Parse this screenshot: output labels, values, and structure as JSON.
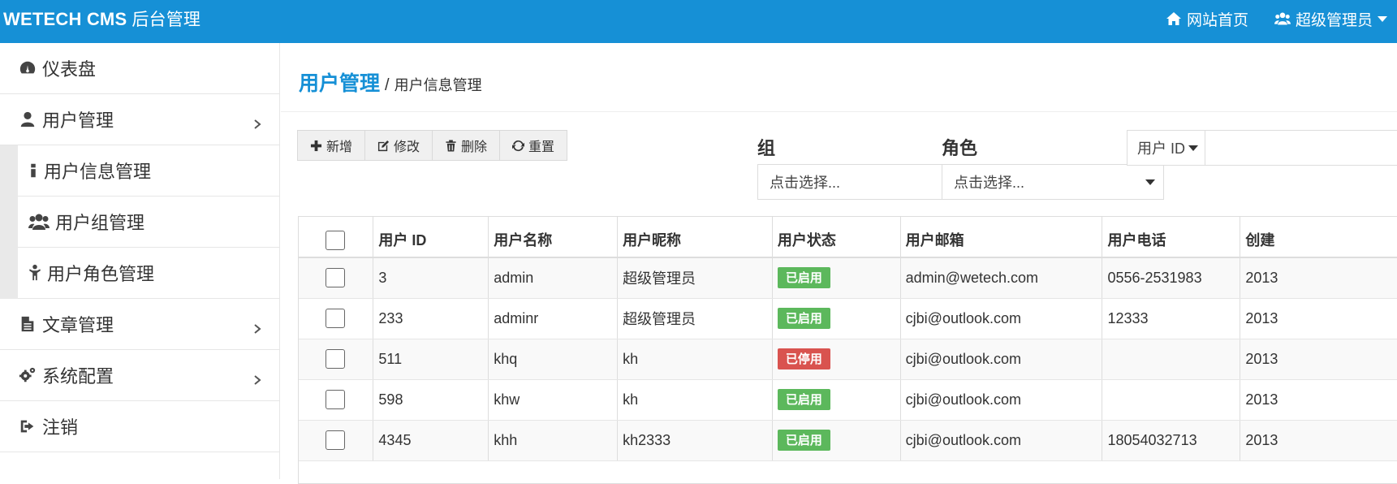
{
  "header": {
    "brand": "WETECH CMS",
    "brand_sub": "后台管理",
    "home_link": "网站首页",
    "user_menu": "超级管理员"
  },
  "sidebar": {
    "items": [
      {
        "label": "仪表盘",
        "icon": "dashboard-icon"
      },
      {
        "label": "用户管理",
        "icon": "user-icon",
        "expanded": true
      },
      {
        "label": "文章管理",
        "icon": "file-icon"
      },
      {
        "label": "系统配置",
        "icon": "gears-icon"
      },
      {
        "label": "注销",
        "icon": "sign-out-icon"
      }
    ],
    "submenu": [
      {
        "label": "用户信息管理",
        "icon": "info-icon"
      },
      {
        "label": "用户组管理",
        "icon": "users-icon"
      },
      {
        "label": "用户角色管理",
        "icon": "child-icon"
      }
    ]
  },
  "page": {
    "title": "用户管理",
    "separator": "/",
    "current": "用户信息管理"
  },
  "toolbar": {
    "add": "新增",
    "edit": "修改",
    "delete": "删除",
    "reset": "重置"
  },
  "filters": {
    "group_label": "组",
    "role_label": "角色",
    "group_placeholder": "点击选择...",
    "role_placeholder": "点击选择...",
    "search_type": "用户 ID",
    "search_value": ""
  },
  "table": {
    "headers": [
      "用户 ID",
      "用户名称",
      "用户昵称",
      "用户状态",
      "用户邮箱",
      "用户电话",
      "创建"
    ],
    "rows": [
      {
        "id": "3",
        "name": "admin",
        "nick": "超级管理员",
        "status": "已启用",
        "email": "admin@wetech.com",
        "phone": "0556-2531983",
        "created": "2013"
      },
      {
        "id": "233",
        "name": "adminr",
        "nick": "超级管理员",
        "status": "已启用",
        "email": "cjbi@outlook.com",
        "phone": "12333",
        "created": "2013"
      },
      {
        "id": "511",
        "name": "khq",
        "nick": "kh",
        "status": "已停用",
        "email": "cjbi@outlook.com",
        "phone": "",
        "created": "2013"
      },
      {
        "id": "598",
        "name": "khw",
        "nick": "kh",
        "status": "已启用",
        "email": "cjbi@outlook.com",
        "phone": "",
        "created": "2013"
      },
      {
        "id": "4345",
        "name": "khh",
        "nick": "kh2333",
        "status": "已启用",
        "email": "cjbi@outlook.com",
        "phone": "18054032713",
        "created": "2013"
      }
    ]
  },
  "colors": {
    "primary": "#1690d6",
    "enabled": "#5cb85c",
    "disabled": "#d9534f"
  }
}
